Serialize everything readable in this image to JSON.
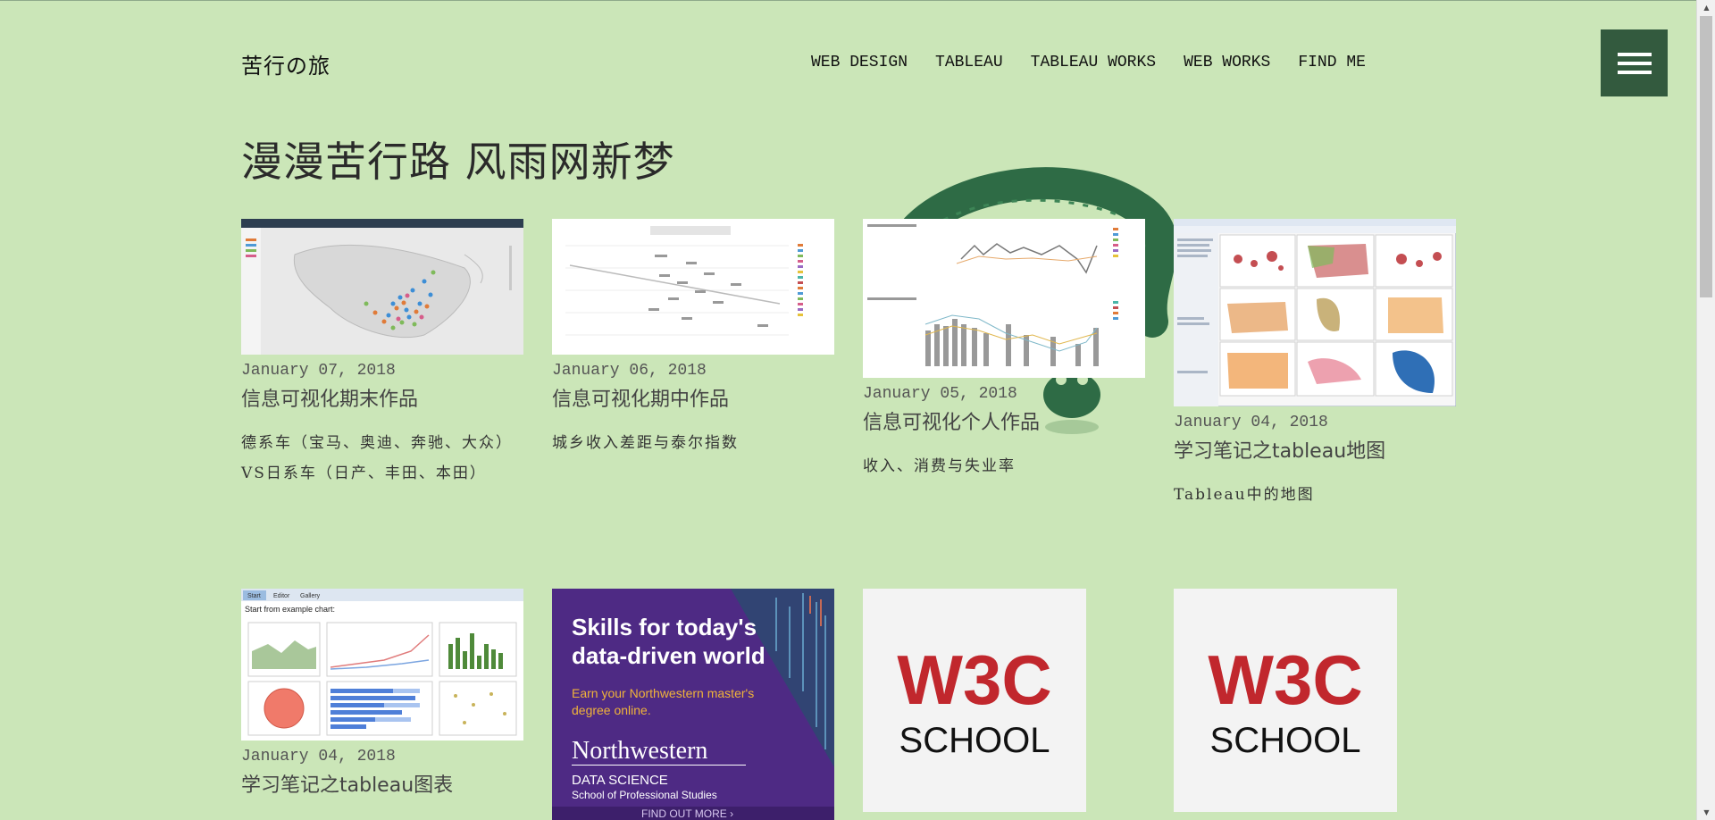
{
  "site": {
    "brand": "苦行の旅",
    "page_title": "漫漫苦行路 风雨网新梦"
  },
  "nav": {
    "items": [
      {
        "label": "WEB DESIGN"
      },
      {
        "label": "TABLEAU"
      },
      {
        "label": "TABLEAU WORKS"
      },
      {
        "label": "WEB WORKS"
      },
      {
        "label": "FIND ME"
      }
    ],
    "menu_icon": "hamburger-menu-icon"
  },
  "posts": [
    {
      "date": "January 07, 2018",
      "title": "信息可视化期末作品",
      "desc": "德系车（宝马、奥迪、奔驰、大众）VS日系车（日产、丰田、本田）"
    },
    {
      "date": "January 06, 2018",
      "title": "信息可视化期中作品",
      "desc": "城乡收入差距与泰尔指数"
    },
    {
      "date": "January 05, 2018",
      "title": "信息可视化个人作品",
      "desc": "收入、消费与失业率"
    },
    {
      "date": "January 04, 2018",
      "title": "学习笔记之tableau地图",
      "desc": "Tableau中的地图"
    },
    {
      "date": "January 04, 2018",
      "title": "学习笔记之tableau图表",
      "desc": ""
    }
  ],
  "ads": {
    "northwestern": {
      "headline": "Skills for today's data-driven world",
      "subline": "Earn your Northwestern master's degree online.",
      "brand": "Northwestern",
      "program": "DATA SCIENCE",
      "school": "School of Professional Studies",
      "cta": "FIND OUT MORE ›"
    },
    "w3c_1": {
      "line1": "W3C",
      "line2": "SCHOOL"
    },
    "w3c_2": {
      "line1": "W3C",
      "line2": "SCHOOL"
    }
  },
  "thumbnails": {
    "chart_example_header": "Start from example chart:",
    "chart_example_tabs": [
      "Start",
      "Editor",
      "Gallery"
    ]
  },
  "colors": {
    "background": "#cbe6b8",
    "menu_button": "#335a3e",
    "snake": "#2e6b45",
    "ad_purple": "#4e2a84",
    "w3c_red": "#c1272d"
  }
}
